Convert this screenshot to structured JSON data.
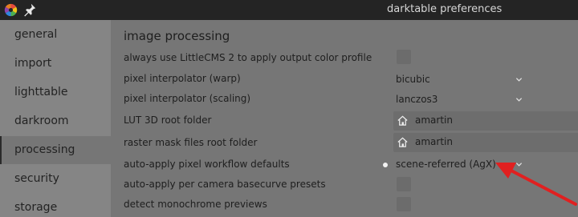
{
  "window": {
    "title": "darktable preferences",
    "logo_icon": "darktable-logo-icon",
    "pin_icon": "pin-icon"
  },
  "sidebar": {
    "items": [
      {
        "label": "general",
        "active": false
      },
      {
        "label": "import",
        "active": false
      },
      {
        "label": "lighttable",
        "active": false
      },
      {
        "label": "darkroom",
        "active": false
      },
      {
        "label": "processing",
        "active": true
      },
      {
        "label": "security",
        "active": false
      },
      {
        "label": "storage",
        "active": false
      }
    ]
  },
  "main": {
    "section_title": "image processing",
    "rows": {
      "littlecms": {
        "label": "always use LittleCMS 2 to apply output color profile",
        "checked": false
      },
      "interp_warp": {
        "label": "pixel interpolator (warp)",
        "value": "bicubic"
      },
      "interp_scaling": {
        "label": "pixel interpolator (scaling)",
        "value": "lanczos3"
      },
      "lut3d": {
        "label": "LUT 3D root folder",
        "value": "amartin"
      },
      "raster_mask": {
        "label": "raster mask files root folder",
        "value": "amartin"
      },
      "workflow": {
        "label": "auto-apply pixel workflow defaults",
        "value": "scene-referred (AgX)",
        "changed_indicator": true
      },
      "basecurve": {
        "label": "auto-apply per camera basecurve presets",
        "checked": false
      },
      "monochrome": {
        "label": "detect monochrome previews",
        "checked": false
      }
    }
  },
  "colors": {
    "titlebar": "#242424",
    "sidebar": "#858585",
    "panel": "#767676",
    "annotation_arrow": "#e02020"
  }
}
